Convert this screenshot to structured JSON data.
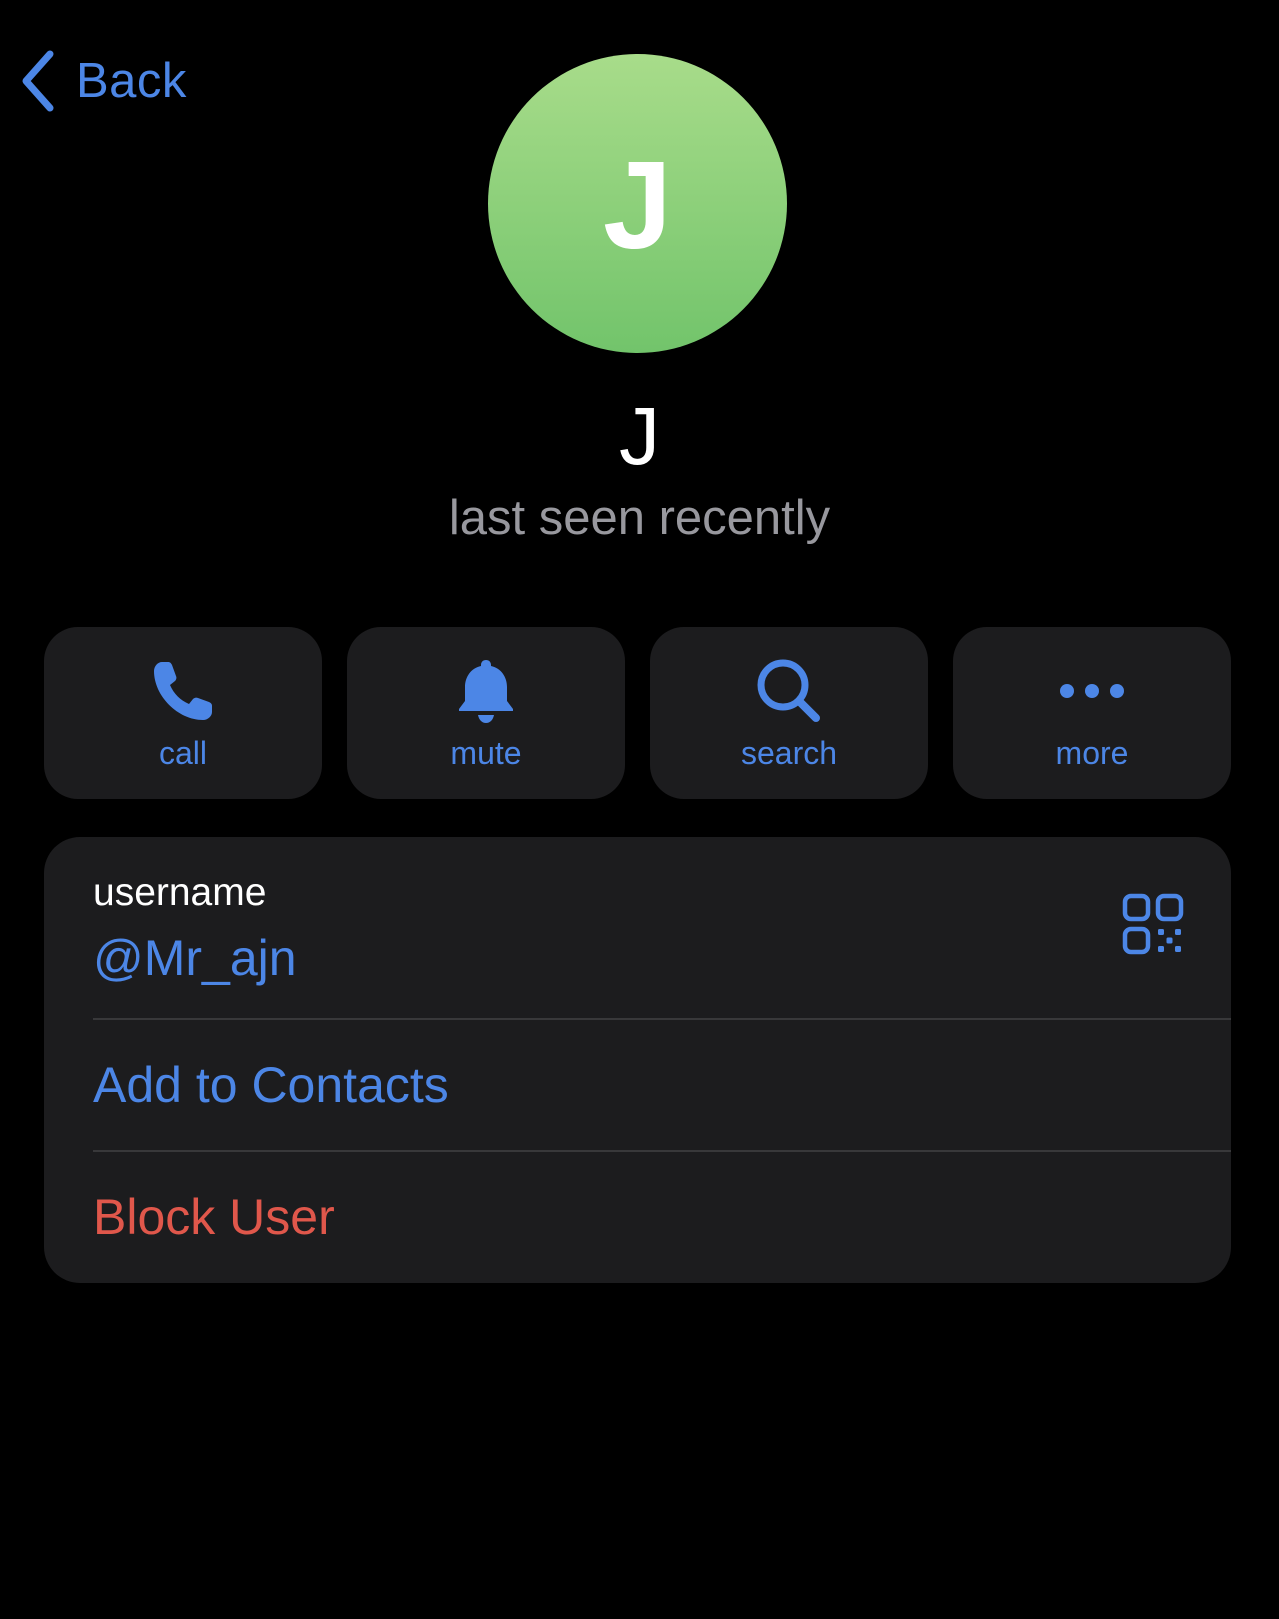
{
  "nav": {
    "back_label": "Back"
  },
  "profile": {
    "avatar_initial": "J",
    "name": "J",
    "status": "last seen recently",
    "avatar_gradient": [
      "#a8dc8a",
      "#72c46b"
    ]
  },
  "actions": [
    {
      "label": "call",
      "icon": "phone-icon"
    },
    {
      "label": "mute",
      "icon": "bell-icon"
    },
    {
      "label": "search",
      "icon": "search-icon"
    },
    {
      "label": "more",
      "icon": "more-icon"
    }
  ],
  "info": {
    "username_label": "username",
    "username_value": "@Mr_ajn",
    "qr_icon": "qr-code-icon",
    "add_contacts_label": "Add to Contacts",
    "block_user_label": "Block User"
  },
  "colors": {
    "accent": "#4c86e6",
    "destructive": "#e0574b",
    "card": "#1c1c1e",
    "secondary_text": "#98989e"
  }
}
